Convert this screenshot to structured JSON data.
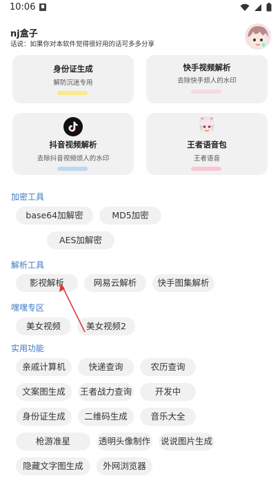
{
  "status_bar": {
    "time": "10:06"
  },
  "header": {
    "title": "nj盒子",
    "subtitle": "话说：如果你对本软件觉得很好用的话可多多分享"
  },
  "cards": [
    {
      "title": "身份证生成",
      "desc": "解防沉迷专用",
      "bar_color": "#fbe98a"
    },
    {
      "title": "快手视频解析",
      "desc": "去除快手烦人的水印",
      "bar_color": "#f8d9e0"
    },
    {
      "title": "抖音视频解析",
      "desc": "去除抖音视频烦人的水印",
      "bar_color": "#bcd8f5",
      "icon": "tiktok-icon"
    },
    {
      "title": "王者语音包",
      "desc": "王者语音",
      "bar_color": "#f9c7d2",
      "icon": "game-character-icon"
    }
  ],
  "sections": {
    "encryption": {
      "label": "加密工具",
      "items": [
        "base64加解密",
        "MD5加密",
        "AES加解密"
      ]
    },
    "parsing": {
      "label": "解析工具",
      "items": [
        "影视解析",
        "网易云解析",
        "快手图集解析"
      ]
    },
    "hehe": {
      "label": "嘿嘿专区",
      "items": [
        "美女视频",
        "美女视频2"
      ]
    },
    "utilities": {
      "label": "实用功能",
      "items": [
        "亲戚计算机",
        "快递查询",
        "农历查询",
        "文案图生成",
        "王者战力查询",
        "开发中",
        "身份证生成",
        "二维码生成",
        "音乐大全",
        "枪游准星",
        "透明头像制作",
        "说说图片生成",
        "隐藏文字图生成",
        "外网浏览器"
      ]
    }
  },
  "colors": {
    "section_label": "#3f78c4",
    "chip_bg": "#f1f1f1",
    "card_bg": "#f1f1f1",
    "annotation_arrow": "#d93a3a"
  }
}
